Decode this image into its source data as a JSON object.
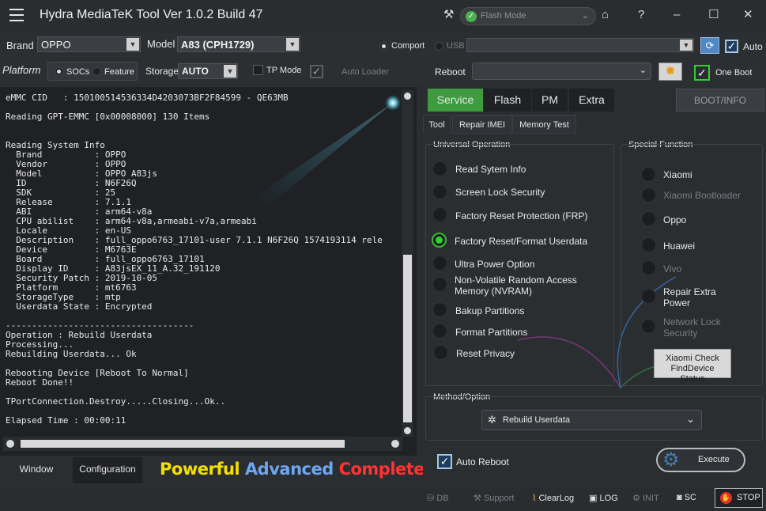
{
  "window": {
    "title": "Hydra MediaTeK Tool  Ver 1.0.2 Build 47",
    "mode": "Flash Mode"
  },
  "device": {
    "brand_label": "Brand",
    "brand_value": "OPPO",
    "model_label": "Model",
    "model_value": "A83 (CPH1729)",
    "comport_label": "Comport",
    "usb_label": "USB",
    "auto_label": "Auto"
  },
  "platform": {
    "label": "Platform",
    "socs_label": "SOCs",
    "feature_label": "Feature",
    "storage_label": "Storage",
    "storage_value": "AUTO",
    "tp_mode_label": "TP Mode",
    "auto_loader_label": "Auto Loader",
    "reboot_label": "Reboot",
    "one_boot_label": "One Boot"
  },
  "log": {
    "lines": "eMMC CID   : 150100514536334D4203073BF2F84599 - QE63MB\n\nReading GPT-EMMC [0x00008000] 130 Items\n\n\nReading System Info\n  Brand          : OPPO\n  Vendor         : OPPO\n  Model          : OPPO A83js\n  ID             : N6F26Q\n  SDK            : 25\n  Release        : 7.1.1\n  ABI            : arm64-v8a\n  CPU abilist    : arm64-v8a,armeabi-v7a,armeabi\n  Locale         : en-US\n  Description    : full_oppo6763_17101-user 7.1.1 N6F26Q 1574193114 rele\n  Device         : M6763E\n  Board          : full_oppo6763_17101\n  Display ID     : A83jsEX_11_A.32_191120\n  Security Patch : 2019-10-05\n  Platform       : mt6763\n  StorageType    : mtp\n  Userdata State : Encrypted\n\n------------------------------------\nOperation : Rebuild Userdata\nProcessing...\nRebuilding Userdata... Ok\n\nRebooting Device [Reboot To Normal]\nReboot Done!!\n\nTPortConnection.Destroy.....Closing...Ok..\n\nElapsed Time : 00:00:11"
  },
  "bottom_tabs": [
    "Window",
    "Configuration"
  ],
  "slogan": {
    "word1": "Powerful",
    "word2": "Advanced",
    "word3": "Complete"
  },
  "tabs": [
    "Service",
    "Flash",
    "PM",
    "Extra"
  ],
  "boot_info_label": "BOOT/INFO",
  "subtabs": [
    "Tool",
    "Repair IMEI",
    "Memory Test"
  ],
  "universal": {
    "title": "Universal Operation",
    "options": [
      "Read Sytem Info",
      "Screen Lock Security",
      "Factory Reset Protection (FRP)",
      "Factory Reset/Format Userdata",
      "Ultra Power Option",
      "Non-Volatile Random Access Memory (NVRAM)",
      "Bakup Partitions",
      "Format Partitions",
      "Reset Privacy"
    ],
    "selected_index": 3
  },
  "special": {
    "title": "Special Function",
    "options": [
      "Xiaomi",
      "Xiaomi Bootloader",
      "Oppo",
      "Huawei",
      "Vivo",
      "Repair Extra Power",
      "Network Lock Security"
    ],
    "check_button": "Xiaomi Check FindDevice Status"
  },
  "method": {
    "title": "Method/Option",
    "value": "Rebuild Userdata"
  },
  "auto_reboot_label": "Auto Reboot",
  "execute_label": "Execute",
  "statusbar": [
    "DB",
    "Support",
    "ClearLog",
    "LOG",
    "INIT",
    "SC",
    "STOP"
  ],
  "colors": {
    "accent_green": "#3e9b3e",
    "slogan_yellow": "#f3e000",
    "slogan_blue": "#6da7f0",
    "slogan_red": "#ff3333"
  }
}
